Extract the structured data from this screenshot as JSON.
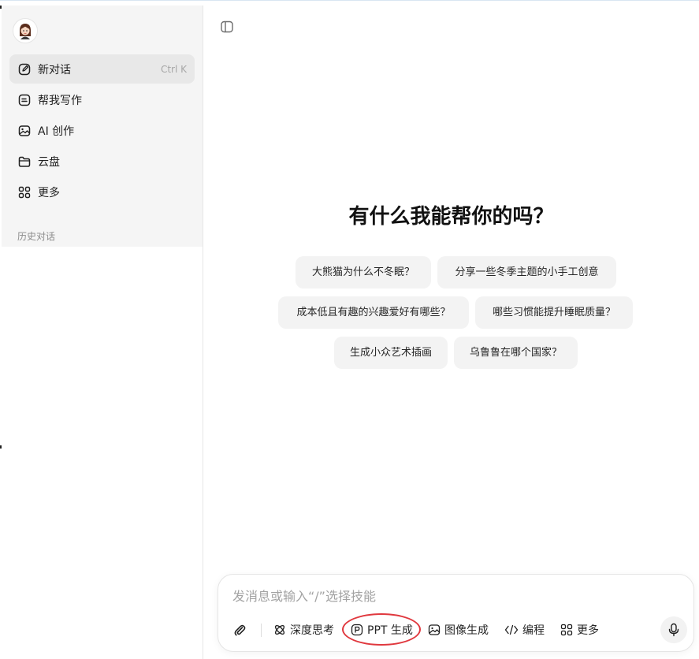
{
  "sidebar": {
    "items": [
      {
        "label": "新对话",
        "shortcut": "Ctrl K",
        "icon": "new-chat-icon"
      },
      {
        "label": "帮我写作",
        "icon": "writing-icon"
      },
      {
        "label": "AI 创作",
        "icon": "image-icon"
      },
      {
        "label": "云盘",
        "icon": "folder-icon"
      },
      {
        "label": "更多",
        "icon": "grid-icon"
      }
    ],
    "history_label": "历史对话"
  },
  "main": {
    "headline": "有什么我能帮你的吗？",
    "suggestions": [
      "大熊猫为什么不冬眠？",
      "分享一些冬季主题的小手工创意",
      "成本低且有趣的兴趣爱好有哪些？",
      "哪些习惯能提升睡眠质量？",
      "生成小众艺术插画",
      "乌鲁鲁在哪个国家？"
    ]
  },
  "composer": {
    "placeholder": "发消息或输入“/”选择技能",
    "tools": [
      {
        "label": "深度思考",
        "icon": "atom-icon"
      },
      {
        "label": "PPT 生成",
        "icon": "ppt-icon"
      },
      {
        "label": "图像生成",
        "icon": "image-icon"
      },
      {
        "label": "编程",
        "icon": "code-icon"
      },
      {
        "label": "更多",
        "icon": "grid-icon"
      }
    ]
  },
  "colors": {
    "accent_highlight": "#e0383e",
    "sidebar_bg": "#f5f5f5",
    "chip_bg": "#f3f3f3"
  }
}
